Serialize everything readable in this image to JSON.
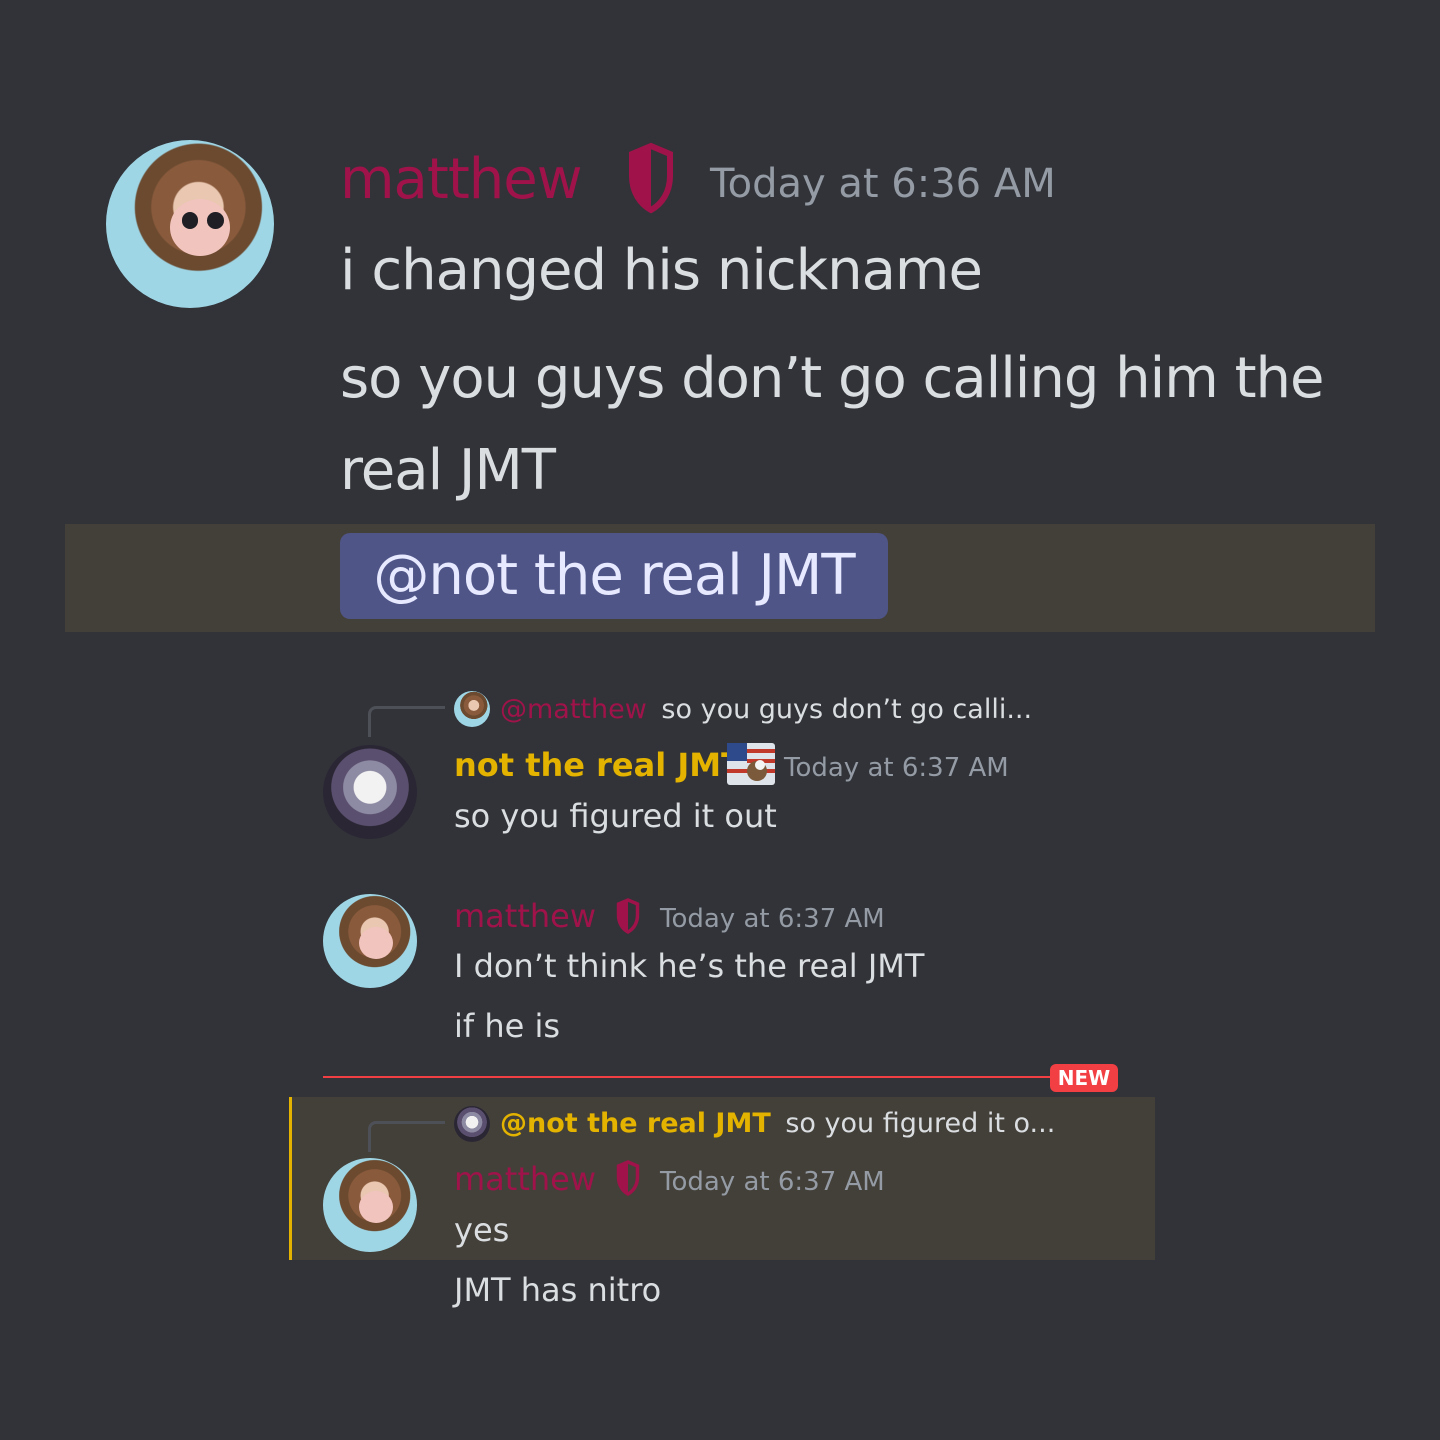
{
  "messages": {
    "first": {
      "author": "matthew",
      "timestamp": "Today at 6:36 AM",
      "lines": [
        "i changed his nickname",
        "so you guys don’t go calling him the",
        "real JMT"
      ],
      "mention": "@not the real JMT"
    },
    "reply1": {
      "reply_to_name": "@matthew",
      "reply_to_snippet": "so you guys don’t go calli...",
      "author": "not the real JMT",
      "timestamp": "Today at 6:37 AM",
      "text": "so you figured it out"
    },
    "second": {
      "author": "matthew",
      "timestamp": "Today at 6:37 AM",
      "lines": [
        "I don’t think he’s the real JMT",
        "if he is"
      ]
    },
    "divider": {
      "badge": "NEW"
    },
    "reply2": {
      "reply_to_name": "@not the real JMT",
      "reply_to_snippet": "so you figured it o...",
      "author": "matthew",
      "timestamp": "Today at 6:37 AM",
      "lines": [
        "yes",
        "JMT has nitro"
      ]
    }
  },
  "colors": {
    "background": "#313338",
    "role_red": "#a0134a",
    "role_gold": "#e3b300",
    "mention_bg": "#4f5587",
    "highlight_bg": "#433f39",
    "new_red": "#f23f43"
  },
  "icons": [
    "shield-icon",
    "flag-eagle-icon",
    "monkey-avatar",
    "ghost-avatar"
  ]
}
